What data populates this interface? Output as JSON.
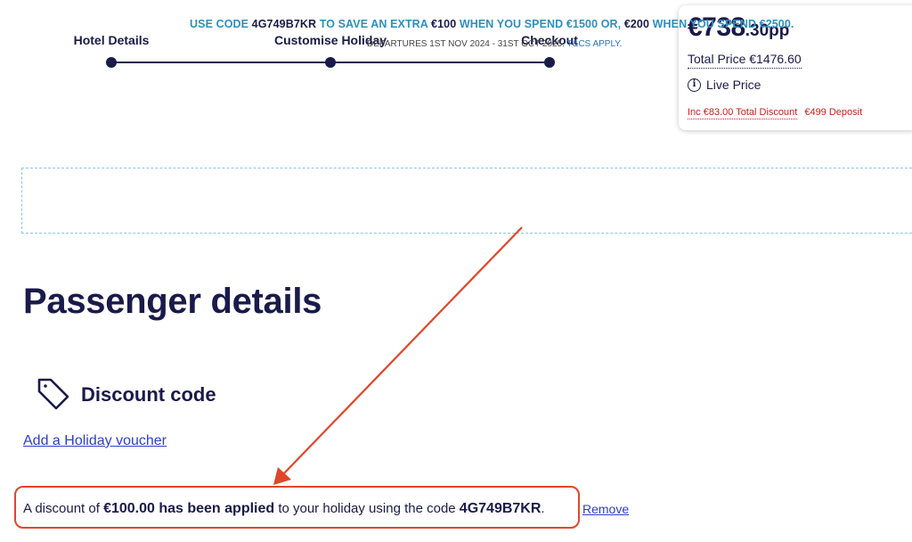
{
  "steps": {
    "hotel_details": "Hotel Details",
    "customise_holiday": "Customise Holiday",
    "checkout": "Checkout"
  },
  "price_card": {
    "price_main": "€738",
    "price_cents": ".30pp",
    "total_price": "Total Price €1476.60",
    "live_price": "Live Price",
    "info_glyph": "i",
    "inc_discount": "Inc €83.00 Total Discount",
    "deposit": "€499 Deposit"
  },
  "promo": {
    "part1": "USE CODE ",
    "code": "4G749B7KR",
    "part2": " TO SAVE AN EXTRA ",
    "amount1": "€100",
    "part3": " WHEN YOU SPEND €1500 OR, ",
    "amount2": "€200",
    "part4": " WHEN YOU SPEND €2500.",
    "departures": "DEPARTURES 1ST NOV 2024 - 31ST OCT 2025. ",
    "tcs": "T&CS APPLY."
  },
  "page_title": "Passenger details",
  "discount": {
    "heading": "Discount code",
    "voucher_link": "Add a Holiday voucher",
    "msg_prefix": "A discount of ",
    "msg_amount": "€100.00 has been applied",
    "msg_middle": " to your holiday using the code ",
    "msg_code": "4G749B7KR",
    "msg_end": ".",
    "remove": "Remove"
  },
  "icons": {
    "tag": "tag-icon",
    "info": "info-icon",
    "arrow": "annotation-arrow"
  },
  "colors": {
    "navy": "#1a1a4b",
    "promo_blue": "#2c8fbf",
    "link_blue": "#2d3ec8",
    "discount_red": "#c8201c",
    "annotation_red": "#e0472a"
  }
}
